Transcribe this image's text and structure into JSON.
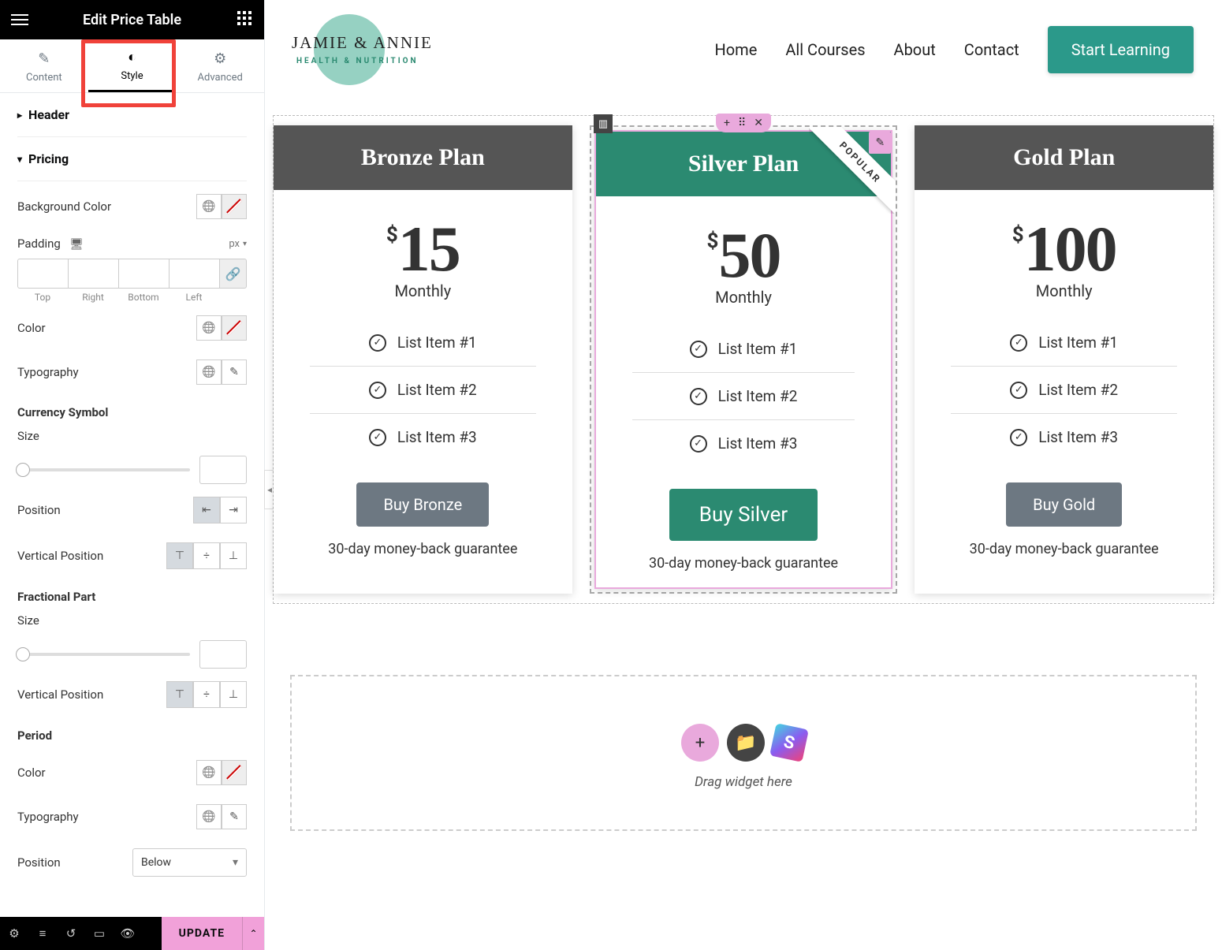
{
  "panel": {
    "title": "Edit Price Table",
    "tabs": {
      "content": "Content",
      "style": "Style",
      "advanced": "Advanced"
    },
    "sections": {
      "header": "Header",
      "pricing": "Pricing"
    },
    "controls": {
      "bgcolor": "Background Color",
      "padding": "Padding",
      "padding_unit": "px",
      "pad_labels": {
        "top": "Top",
        "right": "Right",
        "bottom": "Bottom",
        "left": "Left"
      },
      "color": "Color",
      "typography": "Typography",
      "currency_symbol": "Currency Symbol",
      "size": "Size",
      "position": "Position",
      "vertical_position": "Vertical Position",
      "fractional_part": "Fractional Part",
      "period": "Period",
      "period_position_value": "Below"
    },
    "footer": {
      "update": "UPDATE"
    }
  },
  "site": {
    "logo_main": "JAMIE & ANNIE",
    "logo_sub": "HEALTH & NUTRITION",
    "nav": {
      "home": "Home",
      "courses": "All Courses",
      "about": "About",
      "contact": "Contact"
    },
    "cta": "Start Learning"
  },
  "plans": [
    {
      "name": "Bronze Plan",
      "currency": "$",
      "price": "15",
      "period": "Monthly",
      "features": [
        "List Item #1",
        "List Item #2",
        "List Item #3"
      ],
      "button": "Buy Bronze",
      "guarantee": "30-day money-back guarantee",
      "popular": false,
      "accent": false
    },
    {
      "name": "Silver Plan",
      "currency": "$",
      "price": "50",
      "period": "Monthly",
      "features": [
        "List Item #1",
        "List Item #2",
        "List Item #3"
      ],
      "button": "Buy Silver",
      "guarantee": "30-day money-back guarantee",
      "popular": true,
      "popular_label": "POPULAR",
      "accent": true
    },
    {
      "name": "Gold Plan",
      "currency": "$",
      "price": "100",
      "period": "Monthly",
      "features": [
        "List Item #1",
        "List Item #2",
        "List Item #3"
      ],
      "button": "Buy Gold",
      "guarantee": "30-day money-back guarantee",
      "popular": false,
      "accent": false
    }
  ],
  "drop": {
    "text": "Drag widget here"
  }
}
